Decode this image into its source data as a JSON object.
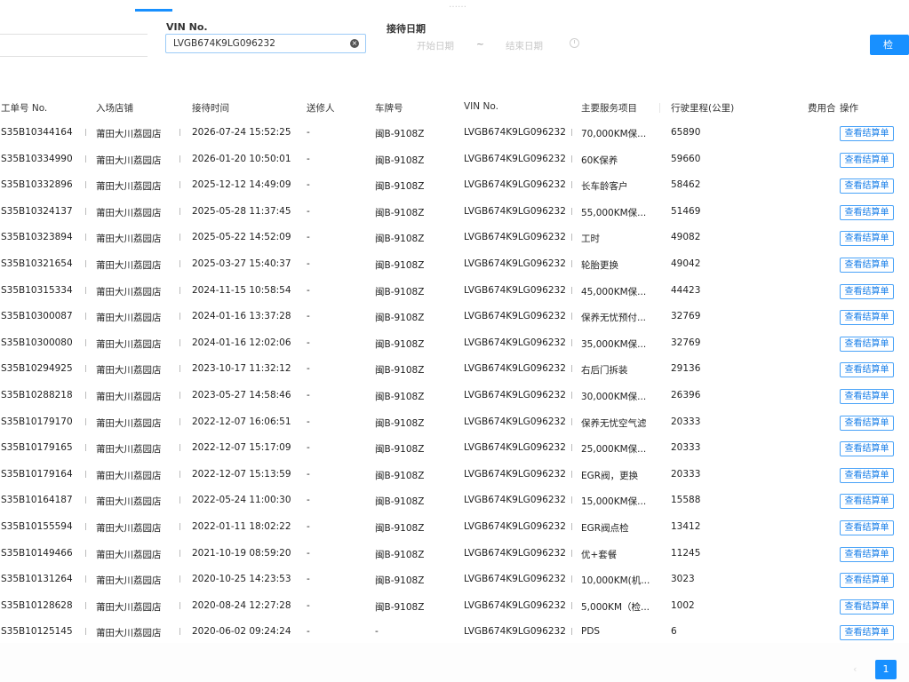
{
  "top_faint": "……",
  "search": {
    "vin_label": "VIN No.",
    "vin_value": "LVGB674K9LG096232",
    "date_label": "接待日期",
    "start_placeholder": "开始日期",
    "range_sep": "~",
    "end_placeholder": "结束日期",
    "search_button": "检 索"
  },
  "table": {
    "headers": [
      "工单号 No.",
      "入场店铺",
      "接待时间",
      "送修人",
      "车牌号",
      "VIN No.",
      "主要服务项目",
      "行驶里程(公里)",
      "费用合",
      "操作"
    ],
    "action_label": "查看结算单",
    "rows": [
      {
        "order": "S35B10344164",
        "store": "莆田大川荔园店",
        "time": "2026-07-24 15:52:25",
        "sender": "-",
        "plate": "闽B-9108Z",
        "vin": "LVGB674K9LG096232",
        "service": "70,000KM保...",
        "mileage": "65890"
      },
      {
        "order": "S35B10334990",
        "store": "莆田大川荔园店",
        "time": "2026-01-20 10:50:01",
        "sender": "-",
        "plate": "闽B-9108Z",
        "vin": "LVGB674K9LG096232",
        "service": "60K保养",
        "mileage": "59660"
      },
      {
        "order": "S35B10332896",
        "store": "莆田大川荔园店",
        "time": "2025-12-12 14:49:09",
        "sender": "-",
        "plate": "闽B-9108Z",
        "vin": "LVGB674K9LG096232",
        "service": "长车龄客户",
        "mileage": "58462"
      },
      {
        "order": "S35B10324137",
        "store": "莆田大川荔园店",
        "time": "2025-05-28 11:37:45",
        "sender": "-",
        "plate": "闽B-9108Z",
        "vin": "LVGB674K9LG096232",
        "service": "55,000KM保...",
        "mileage": "51469"
      },
      {
        "order": "S35B10323894",
        "store": "莆田大川荔园店",
        "time": "2025-05-22 14:52:09",
        "sender": "-",
        "plate": "闽B-9108Z",
        "vin": "LVGB674K9LG096232",
        "service": "工时",
        "mileage": "49082"
      },
      {
        "order": "S35B10321654",
        "store": "莆田大川荔园店",
        "time": "2025-03-27 15:40:37",
        "sender": "-",
        "plate": "闽B-9108Z",
        "vin": "LVGB674K9LG096232",
        "service": "轮胎更换",
        "mileage": "49042"
      },
      {
        "order": "S35B10315334",
        "store": "莆田大川荔园店",
        "time": "2024-11-15 10:58:54",
        "sender": "-",
        "plate": "闽B-9108Z",
        "vin": "LVGB674K9LG096232",
        "service": "45,000KM保...",
        "mileage": "44423"
      },
      {
        "order": "S35B10300087",
        "store": "莆田大川荔园店",
        "time": "2024-01-16 13:37:28",
        "sender": "-",
        "plate": "闽B-9108Z",
        "vin": "LVGB674K9LG096232",
        "service": "保养无忧预付...",
        "mileage": "32769"
      },
      {
        "order": "S35B10300080",
        "store": "莆田大川荔园店",
        "time": "2024-01-16 12:02:06",
        "sender": "-",
        "plate": "闽B-9108Z",
        "vin": "LVGB674K9LG096232",
        "service": "35,000KM保...",
        "mileage": "32769"
      },
      {
        "order": "S35B10294925",
        "store": "莆田大川荔园店",
        "time": "2023-10-17 11:32:12",
        "sender": "-",
        "plate": "闽B-9108Z",
        "vin": "LVGB674K9LG096232",
        "service": "右后门拆装",
        "mileage": "29136"
      },
      {
        "order": "S35B10288218",
        "store": "莆田大川荔园店",
        "time": "2023-05-27 14:58:46",
        "sender": "-",
        "plate": "闽B-9108Z",
        "vin": "LVGB674K9LG096232",
        "service": "30,000KM保...",
        "mileage": "26396"
      },
      {
        "order": "S35B10179170",
        "store": "莆田大川荔园店",
        "time": "2022-12-07 16:06:51",
        "sender": "-",
        "plate": "闽B-9108Z",
        "vin": "LVGB674K9LG096232",
        "service": "保养无忧空气滤",
        "mileage": "20333"
      },
      {
        "order": "S35B10179165",
        "store": "莆田大川荔园店",
        "time": "2022-12-07 15:17:09",
        "sender": "-",
        "plate": "闽B-9108Z",
        "vin": "LVGB674K9LG096232",
        "service": "25,000KM保...",
        "mileage": "20333"
      },
      {
        "order": "S35B10179164",
        "store": "莆田大川荔园店",
        "time": "2022-12-07 15:13:59",
        "sender": "-",
        "plate": "闽B-9108Z",
        "vin": "LVGB674K9LG096232",
        "service": "EGR阀，更换",
        "mileage": "20333"
      },
      {
        "order": "S35B10164187",
        "store": "莆田大川荔园店",
        "time": "2022-05-24 11:00:30",
        "sender": "-",
        "plate": "闽B-9108Z",
        "vin": "LVGB674K9LG096232",
        "service": "15,000KM保...",
        "mileage": "15588"
      },
      {
        "order": "S35B10155594",
        "store": "莆田大川荔园店",
        "time": "2022-01-11 18:02:22",
        "sender": "-",
        "plate": "闽B-9108Z",
        "vin": "LVGB674K9LG096232",
        "service": "EGR阀点检",
        "mileage": "13412"
      },
      {
        "order": "S35B10149466",
        "store": "莆田大川荔园店",
        "time": "2021-10-19 08:59:20",
        "sender": "-",
        "plate": "闽B-9108Z",
        "vin": "LVGB674K9LG096232",
        "service": "优+套餐",
        "mileage": "11245"
      },
      {
        "order": "S35B10131264",
        "store": "莆田大川荔园店",
        "time": "2020-10-25 14:23:53",
        "sender": "-",
        "plate": "闽B-9108Z",
        "vin": "LVGB674K9LG096232",
        "service": "10,000KM(机...",
        "mileage": "3023"
      },
      {
        "order": "S35B10128628",
        "store": "莆田大川荔园店",
        "time": "2020-08-24 12:27:28",
        "sender": "-",
        "plate": "闽B-9108Z",
        "vin": "LVGB674K9LG096232",
        "service": "5,000KM（检...",
        "mileage": "1002"
      },
      {
        "order": "S35B10125145",
        "store": "莆田大川荔园店",
        "time": "2020-06-02 09:24:24",
        "sender": "-",
        "plate": "-",
        "vin": "LVGB674K9LG096232",
        "service": "PDS",
        "mileage": "6"
      }
    ]
  },
  "pagination": {
    "prev": "‹",
    "current": "1"
  }
}
